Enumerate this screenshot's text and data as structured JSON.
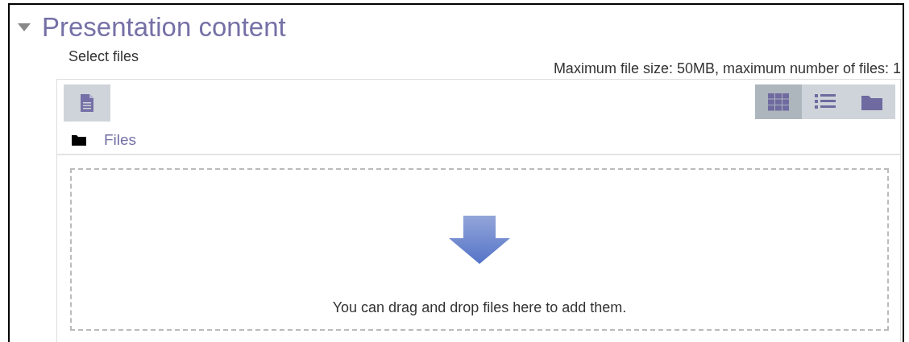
{
  "section": {
    "title": "Presentation content",
    "expanded": true
  },
  "field": {
    "label": "Select files",
    "limits": "Maximum file size: 50MB, maximum number of files: 1"
  },
  "view_buttons": [
    {
      "kind": "grid",
      "selected": true
    },
    {
      "kind": "list",
      "selected": false
    },
    {
      "kind": "tree",
      "selected": false
    }
  ],
  "path": "Files",
  "dropzone": {
    "message": "You can drag and drop files here to add them."
  }
}
